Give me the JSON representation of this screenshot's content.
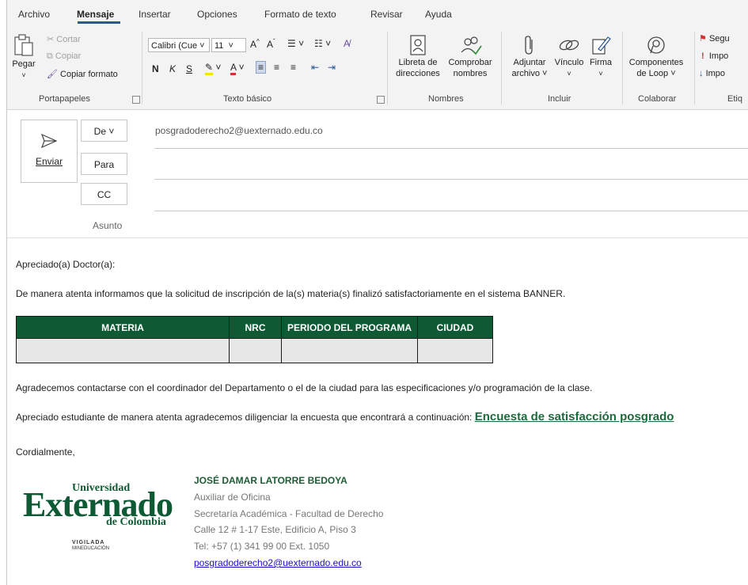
{
  "menu": {
    "tabs": [
      "Archivo",
      "Mensaje",
      "Insertar",
      "Opciones",
      "Formato de texto",
      "Revisar",
      "Ayuda"
    ],
    "active": "Mensaje"
  },
  "ribbon": {
    "clipboard": {
      "paste": "Pegar",
      "cut": "Cortar",
      "copy": "Copiar",
      "format_painter": "Copiar formato",
      "group_label": "Portapapeles"
    },
    "basic_text": {
      "font_name": "Calibri (Cue",
      "font_size": "11",
      "bold": "N",
      "italic": "K",
      "underline": "S",
      "group_label": "Texto básico"
    },
    "names": {
      "address_book_line1": "Libreta de",
      "address_book_line2": "direcciones",
      "check_names_line1": "Comprobar",
      "check_names_line2": "nombres",
      "group_label": "Nombres"
    },
    "include": {
      "attach_line1": "Adjuntar",
      "attach_line2": "archivo ˅",
      "link": "Vínculo",
      "signature": "Firma",
      "group_label": "Incluir"
    },
    "collaborate": {
      "loop_line1": "Componentes",
      "loop_line2": "de Loop ˅",
      "group_label": "Colaborar"
    },
    "tags": {
      "followup": "Segu",
      "high": "Impo",
      "low": "Impo",
      "group_label": "Etiq"
    }
  },
  "compose": {
    "send_label": "Enviar",
    "from_button": "De ˅",
    "to_button": "Para",
    "cc_button": "CC",
    "subject_label": "Asunto",
    "from_address": "posgradoderecho2@uexternado.edu.co"
  },
  "message": {
    "greeting": "Apreciado(a) Doctor(a):",
    "intro": "De manera atenta informamos que la solicitud de inscripción de la(s) materia(s) finalizó satisfactoriamente en el sistema BANNER.",
    "table": {
      "headers": [
        "MATERIA",
        "NRC",
        "PERIODO DEL PROGRAMA",
        "CIUDAD"
      ],
      "rows": [
        [
          "",
          "",
          "",
          ""
        ]
      ]
    },
    "thanks": "Agradecemos contactarse con el coordinador del Departamento o el de la ciudad para las especificaciones y/o programación de la clase.",
    "survey_text": "Apreciado estudiante de manera atenta agradecemos diligenciar la encuesta que encontrará a continuación: ",
    "survey_link": "Encuesta de satisfacción posgrado",
    "closing": "Cordialmente,"
  },
  "logo": {
    "universidad": "Universidad",
    "externado": "Externado",
    "de_colombia": "de Colombia",
    "vigilada": "VIGILADA",
    "mineducacion": "MINEDUCACIÓN"
  },
  "signature": {
    "name": "JOSÉ DAMAR LATORRE BEDOYA",
    "title": "Auxiliar de Oficina",
    "department": "Secretaría Académica - Facultad de Derecho",
    "address": "Calle 12 # 1-17 Este, Edificio A, Piso 3",
    "phone": "Tel: +57 (1) 341 99 00 Ext. 1050",
    "email": "posgradoderecho2@uexternado.edu.co"
  },
  "colors": {
    "brand_green": "#0e5a34",
    "accent_blue": "#2b5797",
    "link_blue": "#1a0dcc"
  }
}
